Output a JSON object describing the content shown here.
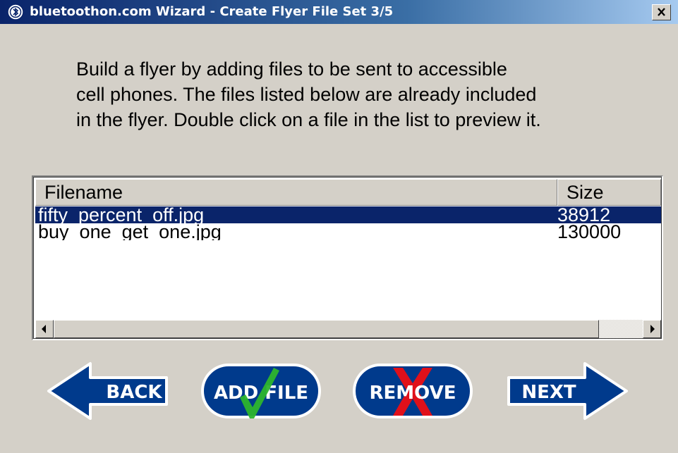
{
  "window": {
    "title": "bluetoothon.com Wizard - Create Flyer File Set 3/5",
    "icon": "bluetooth-b-icon",
    "close_icon": "close-x-icon"
  },
  "instructions": "Build a flyer by adding files to be sent to accessible\ncell phones. The files listed below are already included\nin the flyer. Double click on a file in the list to preview it.",
  "file_list": {
    "columns": [
      "Filename",
      "Size"
    ],
    "rows": [
      {
        "filename": "fifty_percent_off.jpg",
        "size": "38912",
        "selected": true
      },
      {
        "filename": "buy_one_get_one.jpg",
        "size": "130000",
        "selected": false
      }
    ],
    "scroll_left_icon": "arrow-left-icon",
    "scroll_right_icon": "arrow-right-icon"
  },
  "buttons": {
    "back": "BACK",
    "add_file": "ADD FILE",
    "remove": "REMOVE",
    "next": "NEXT"
  },
  "colors": {
    "button_fill": "#003a8c",
    "selection": "#0a246a",
    "check_green": "#2db52d",
    "remove_red": "#e0101a"
  }
}
